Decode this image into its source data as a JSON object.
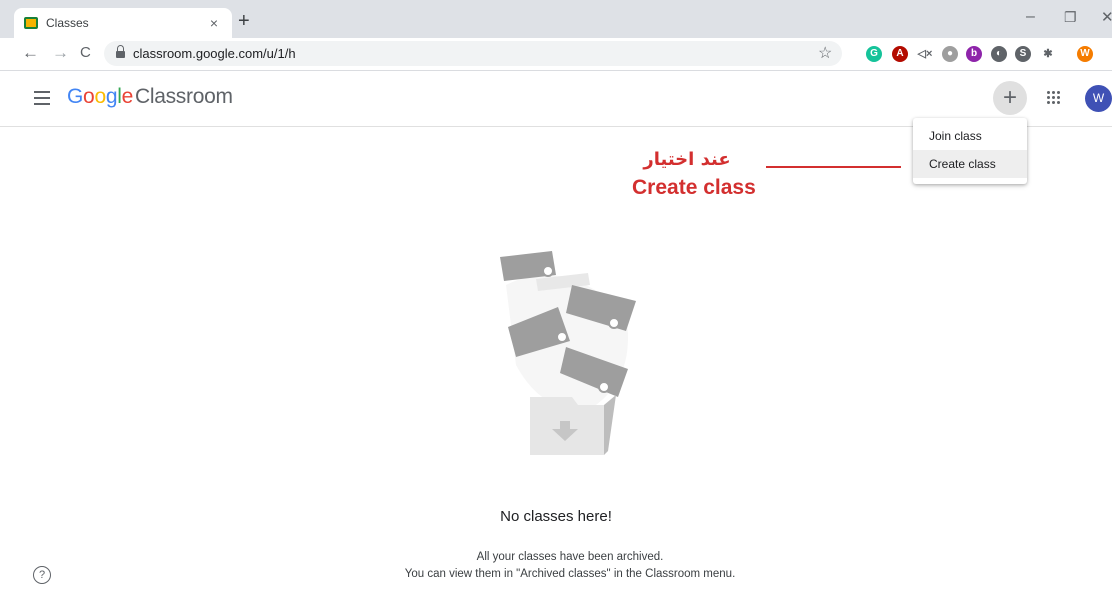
{
  "browser": {
    "tab_title": "Classes",
    "tab_close": "×",
    "new_tab": "+",
    "window_minimize": "–",
    "window_restore": "❐",
    "window_close": "✕",
    "back": "←",
    "forward": "→",
    "reload": "C",
    "url": "classroom.google.com/u/1/h",
    "bookmark_star": "☆",
    "extensions": [
      {
        "icon": "grammarly-icon",
        "color": "#15c39a",
        "glyph": "G"
      },
      {
        "icon": "acrobat-icon",
        "color": "#b30b00",
        "glyph": "A"
      },
      {
        "icon": "mute-icon",
        "color": "#ffffff",
        "glyph": "◁×"
      },
      {
        "icon": "bug-icon",
        "color": "#9e9e9e",
        "glyph": "●"
      },
      {
        "icon": "b-ext-icon",
        "color": "#8e24aa",
        "glyph": "b"
      },
      {
        "icon": "chart-ext-icon",
        "color": "#5f6368",
        "glyph": "◐"
      },
      {
        "icon": "s-ext-icon",
        "color": "#5f6368",
        "glyph": "S"
      },
      {
        "icon": "puzzle-icon",
        "color": "#ffffff",
        "glyph": "✱"
      },
      {
        "icon": "profile-icon",
        "color": "#f57c00",
        "glyph": "W"
      }
    ]
  },
  "header": {
    "logo_letters": [
      "G",
      "o",
      "o",
      "g",
      "l",
      "e"
    ],
    "product": "Classroom",
    "add_button": "+",
    "avatar": "W"
  },
  "menu": {
    "items": [
      {
        "label": "Join class",
        "highlighted": false
      },
      {
        "label": "Create class",
        "highlighted": true
      }
    ]
  },
  "annotation": {
    "arabic": "عند اختيار",
    "english": "Create class",
    "color": "#d32f2f"
  },
  "empty_state": {
    "title": "No classes here!",
    "line1": "All your classes have been archived.",
    "line2": "You can view them in \"Archived classes\" in the Classroom menu."
  },
  "help": "?"
}
